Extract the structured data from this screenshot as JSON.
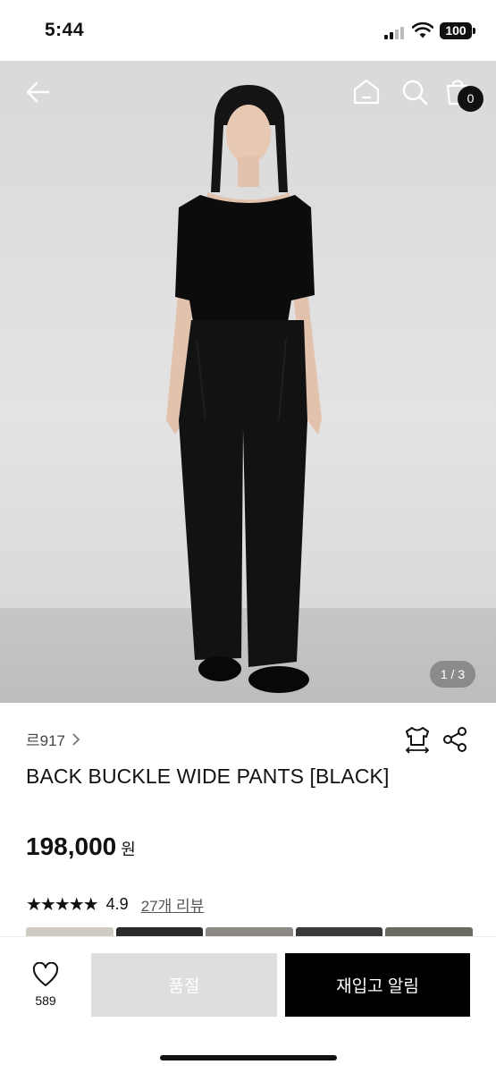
{
  "status_bar": {
    "time": "5:44",
    "battery": "100"
  },
  "header": {
    "back_icon": "arrow-left-icon",
    "home_icon": "home-icon",
    "search_icon": "search-icon",
    "cart_icon": "shopping-bag-icon",
    "cart_count": "0"
  },
  "gallery": {
    "pager": "1 / 3"
  },
  "product": {
    "brand": "르917",
    "title": "BACK BUCKLE WIDE PANTS [BLACK]",
    "price": "198,000",
    "currency": "원",
    "rating": "4.9",
    "stars": "★★★★★",
    "review_link": "27개 리뷰",
    "size_icon": "size-guide-icon",
    "share_icon": "share-icon"
  },
  "bottom_bar": {
    "like_count": "589",
    "soldout_label": "품절",
    "restock_label": "재입고 알림"
  },
  "colors": {
    "accent": "#000000",
    "disabled": "#dedede"
  }
}
